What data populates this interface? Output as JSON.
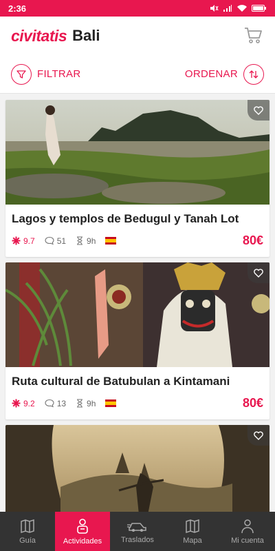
{
  "status": {
    "time": "2:36"
  },
  "header": {
    "logo": "civitatis",
    "city": "Bali"
  },
  "filters": {
    "filter_label": "FILTRAR",
    "sort_label": "ORDENAR"
  },
  "cards": [
    {
      "title": "Lagos y templos de Bedugul y Tanah Lot",
      "rating": "9.7",
      "reviews": "51",
      "duration": "9h",
      "price": "80€"
    },
    {
      "title": "Ruta cultural de Batubulan a Kintamani",
      "rating": "9.2",
      "reviews": "13",
      "duration": "9h",
      "price": "80€"
    }
  ],
  "tabs": [
    {
      "label": "Guía",
      "icon": "map-guide-icon"
    },
    {
      "label": "Actividades",
      "icon": "activities-icon"
    },
    {
      "label": "Traslados",
      "icon": "car-icon"
    },
    {
      "label": "Mapa",
      "icon": "map-icon"
    },
    {
      "label": "Mi cuenta",
      "icon": "user-icon"
    }
  ],
  "colors": {
    "brand": "#e8174f",
    "tabbar": "#333333"
  }
}
